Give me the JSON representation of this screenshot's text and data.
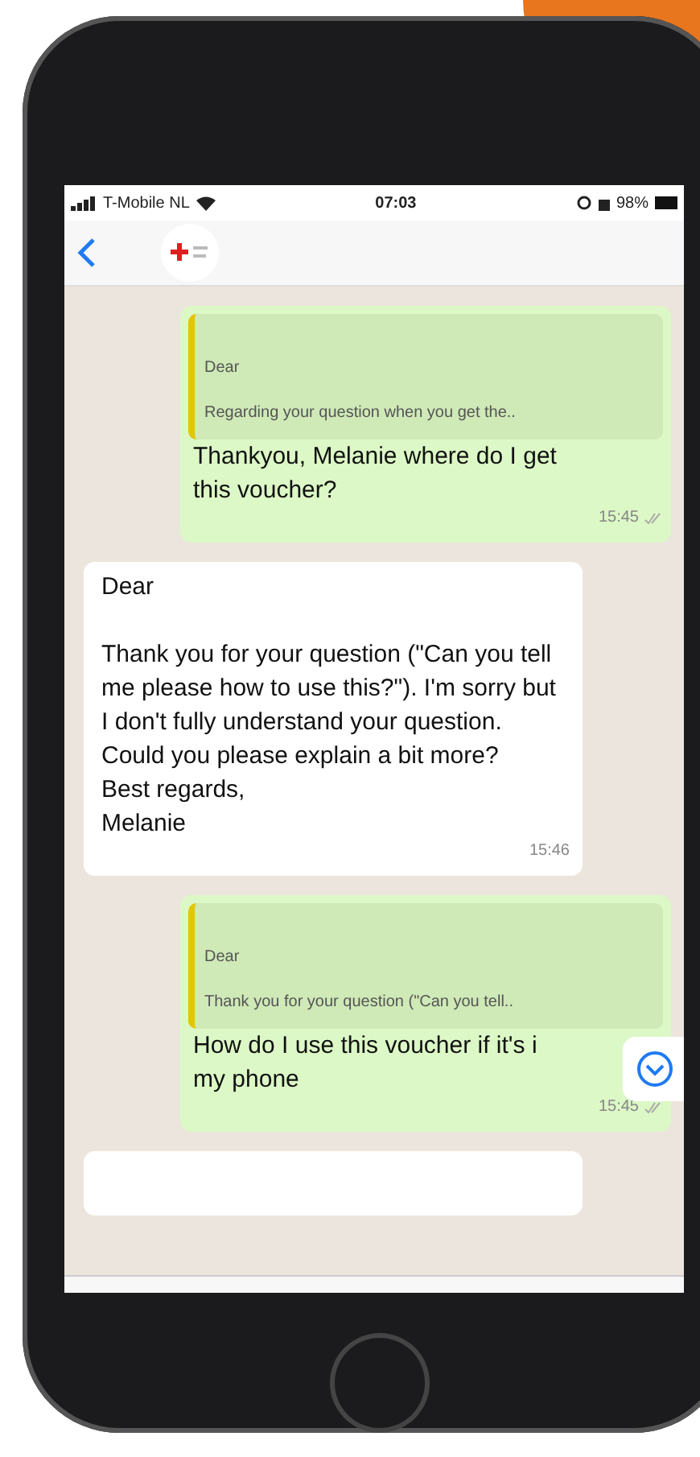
{
  "status_bar": {
    "carrier": "T-Mobile NL",
    "time": "07:03",
    "battery": "98%"
  },
  "messages": [
    {
      "kind": "outgoing",
      "quote": {
        "title": "Dear",
        "text": "Regarding your question when you get the.."
      },
      "text": "Thankyou, Melanie where do I get\nthis voucher?",
      "time": "15:45",
      "read": true
    },
    {
      "kind": "incoming",
      "text": "Dear\n\nThank you for your question (\"Can you tell me please how to use this?\"). I'm sorry but I don't fully understand your question. Could you please explain a bit more?\nBest regards,\nMelanie",
      "time": "15:46"
    },
    {
      "kind": "outgoing",
      "quote": {
        "title": "Dear",
        "text": "Thank you for your question (\"Can you tell.."
      },
      "text": "How do I use this voucher if it's i\nmy phone",
      "time": "15:45",
      "read": true
    },
    {
      "kind": "incoming_cut"
    }
  ]
}
